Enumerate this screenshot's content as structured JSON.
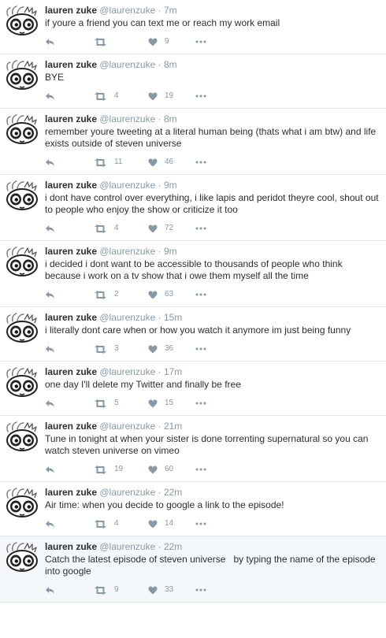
{
  "colors": {
    "text": "#292f33",
    "meta": "#8899a6",
    "border": "#e1e8ed",
    "highlight_bg": "#f5f8fa"
  },
  "icons": {
    "avatar": "panda-face-avatar",
    "reply": "reply-arrow-icon",
    "retweet": "retweet-icon",
    "like": "heart-icon",
    "more": "more-dots-icon"
  },
  "tweets": [
    {
      "name": "lauren zuke",
      "handle": "@laurenzuke",
      "sep": "·",
      "time": "7m",
      "text": "if youre a friend you can text me or reach my work email",
      "retweets": "",
      "likes": "9"
    },
    {
      "name": "lauren zuke",
      "handle": "@laurenzuke",
      "sep": "·",
      "time": "8m",
      "text": "BYE",
      "retweets": "4",
      "likes": "19"
    },
    {
      "name": "lauren zuke",
      "handle": "@laurenzuke",
      "sep": "·",
      "time": "8m",
      "text": "remember youre tweeting at a literal human being (thats what i am btw) and life exists outside of steven universe",
      "retweets": "11",
      "likes": "46"
    },
    {
      "name": "lauren zuke",
      "handle": "@laurenzuke",
      "sep": "·",
      "time": "9m",
      "text": "i dont have control over everything, i like lapis and peridot theyre cool, shout out to people who enjoy the show or criticize it too",
      "retweets": "4",
      "likes": "72"
    },
    {
      "name": "lauren zuke",
      "handle": "@laurenzuke",
      "sep": "·",
      "time": "9m",
      "text": "i decided i dont want to be accessible to thousands of people who think because i work on a tv show that i owe them myself all the time",
      "retweets": "2",
      "likes": "63"
    },
    {
      "name": "lauren zuke",
      "handle": "@laurenzuke",
      "sep": "·",
      "time": "15m",
      "text": "i literally dont care when or how you watch it anymore im just being funny",
      "retweets": "3",
      "likes": "36"
    },
    {
      "name": "lauren zuke",
      "handle": "@laurenzuke",
      "sep": "·",
      "time": "17m",
      "text": "one day I'll delete my Twitter and finally be free",
      "retweets": "5",
      "likes": "15"
    },
    {
      "name": "lauren zuke",
      "handle": "@laurenzuke",
      "sep": "·",
      "time": "21m",
      "text": "Tune in tonight at when your sister is done torrenting supernatural so you can watch steven universe on vimeo",
      "retweets": "19",
      "likes": "60"
    },
    {
      "name": "lauren zuke",
      "handle": "@laurenzuke",
      "sep": "·",
      "time": "22m",
      "text": "Air time: when you decide to google a link to the episode!",
      "retweets": "4",
      "likes": "14"
    },
    {
      "name": "lauren zuke",
      "handle": "@laurenzuke",
      "sep": "·",
      "time": "22m",
      "text": "Catch the latest episode of steven universe   by typing the name of the episode into google",
      "retweets": "9",
      "likes": "33"
    }
  ]
}
